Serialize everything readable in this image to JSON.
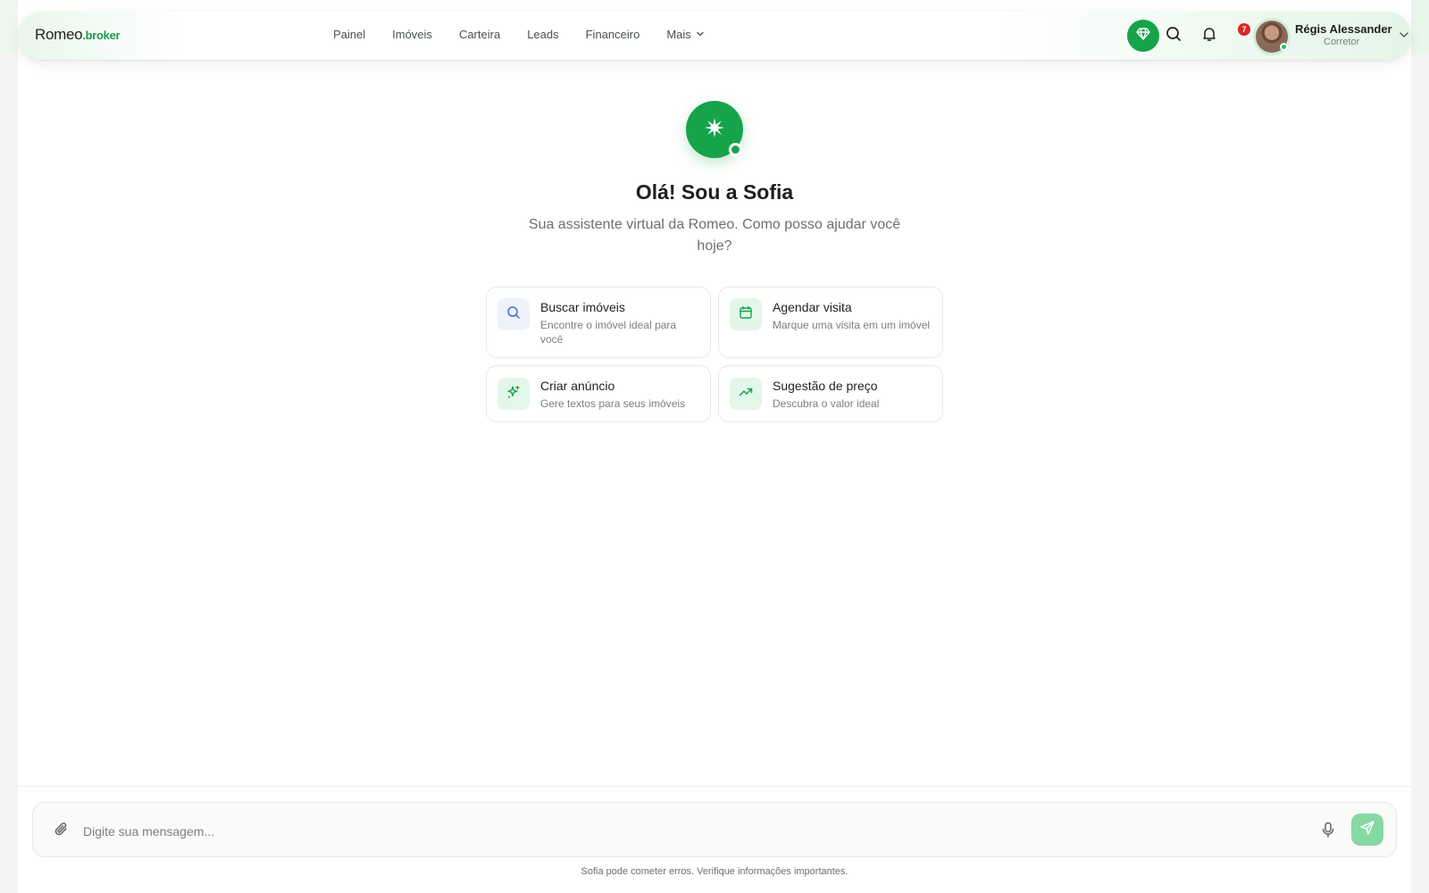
{
  "header": {
    "logo_main": "Romeo",
    "logo_suffix": ".broker",
    "nav": [
      {
        "label": "Painel"
      },
      {
        "label": "Imóveis"
      },
      {
        "label": "Carteira"
      },
      {
        "label": "Leads"
      },
      {
        "label": "Financeiro"
      },
      {
        "label": "Mais"
      }
    ],
    "notifications_count": "7",
    "user": {
      "name": "Régis Alessander",
      "role": "Corretor"
    },
    "icons": [
      "diamond-icon",
      "search-icon",
      "bell-icon",
      "chevron-down-icon"
    ]
  },
  "assistant": {
    "title": "Olá! Sou a Sofia",
    "subtitle": "Sua assistente virtual da Romeo. Como posso ajudar você hoje?"
  },
  "suggestions": [
    {
      "title": "Buscar imóveis",
      "description": "Encontre o imóvel ideal para você",
      "icon": "search-icon",
      "icon_color": "#3b6fd6",
      "icon_bg": "#eef3fb"
    },
    {
      "title": "Agendar visita",
      "description": "Marque uma visita em um imóvel",
      "icon": "calendar-icon",
      "icon_color": "#16a34a",
      "icon_bg": "#e3f6e9"
    },
    {
      "title": "Criar anúncio",
      "description": "Gere textos para seus imóveis",
      "icon": "sparkles-icon",
      "icon_color": "#16a34a",
      "icon_bg": "#e3f6e9"
    },
    {
      "title": "Sugestão de preço",
      "description": "Descubra o valor ideal",
      "icon": "trending-up-icon",
      "icon_color": "#16a34a",
      "icon_bg": "#e3f6e9"
    }
  ],
  "composer": {
    "placeholder": "Digite sua mensagem...",
    "value": ""
  },
  "disclaimer": "Sofia pode cometer erros. Verifique informações importantes.",
  "colors": {
    "accent": "#16a34a",
    "send_disabled": "#86d9a3",
    "badge": "#dc2626"
  }
}
